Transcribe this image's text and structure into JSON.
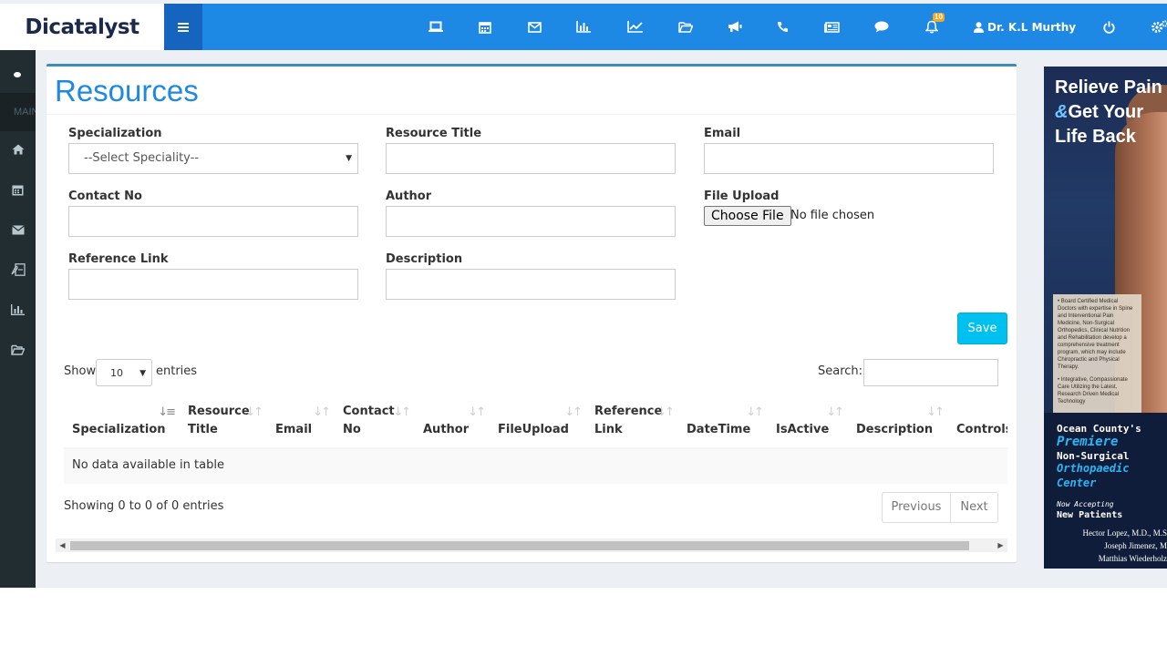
{
  "header": {
    "logo_text": "Dicatalyst",
    "nav_icons": [
      "desktop-icon",
      "calendar-icon",
      "envelope-icon",
      "bar-chart-icon",
      "line-chart-icon",
      "folder-open-icon",
      "bullhorn-icon",
      "phone-icon",
      "newspaper-icon",
      "comment-icon",
      "bell-icon"
    ],
    "notification_count": "10",
    "user_name": "Dr. K.L Murthy",
    "brand_color": "#1e88e5"
  },
  "sidebar": {
    "header_label": "MAIN",
    "items": [
      "home-icon",
      "calendar-icon",
      "envelope-icon",
      "file-pdf-icon",
      "bar-chart-icon",
      "folder-open-icon"
    ]
  },
  "page": {
    "title": "Resources",
    "form": {
      "specialization_label": "Specialization",
      "specialization_value": "--Select Speciality--",
      "resource_title_label": "Resource Title",
      "email_label": "Email",
      "contact_no_label": "Contact No",
      "author_label": "Author",
      "file_upload_label": "File Upload",
      "choose_file_label": "Choose File",
      "no_file_text": "No file chosen",
      "reference_link_label": "Reference Link",
      "description_label": "Description",
      "save_label": "Save"
    },
    "table": {
      "show_label": "Show",
      "entries_label": "entries",
      "page_length": "10",
      "search_label": "Search:",
      "columns": [
        "Specialization",
        "Resource Title",
        "Email",
        "Contact No",
        "Author",
        "FileUpload",
        "Reference Link",
        "DateTime",
        "IsActive",
        "Description",
        "Controls"
      ],
      "empty_text": "No data available in table",
      "info_text": "Showing 0 to 0 of 0 entries",
      "previous_label": "Previous",
      "next_label": "Next"
    }
  },
  "ad": {
    "headline_1": "Relieve Pain",
    "headline_amp": "&",
    "headline_2": "Get Your",
    "headline_3": "Life Back",
    "bullet_1": "• Board Certified Medical Doctors with expertise in Spine and Interventional Pain Medicine, Non-Surgical Orthopedics, Clinical Nutrition and Rehabilitation develop a comprehensive treatment program, which may include Chiropractic and Physical Therapy.",
    "bullet_2": "• Integrative, Compassionate Care Utilizing the Latest, Research Driven Medical Technology",
    "line_1": "Ocean County's",
    "line_2": "Premiere",
    "line_3": "Non-Surgical",
    "line_4": "Orthopaedic",
    "line_5": "Center",
    "line_6": "Now Accepting",
    "line_7": "New Patients",
    "name_1": "Hector Lopez, M.D., M.S",
    "name_2": "Joseph Jimenez, M",
    "name_3": "Matthias Wiederholz"
  }
}
